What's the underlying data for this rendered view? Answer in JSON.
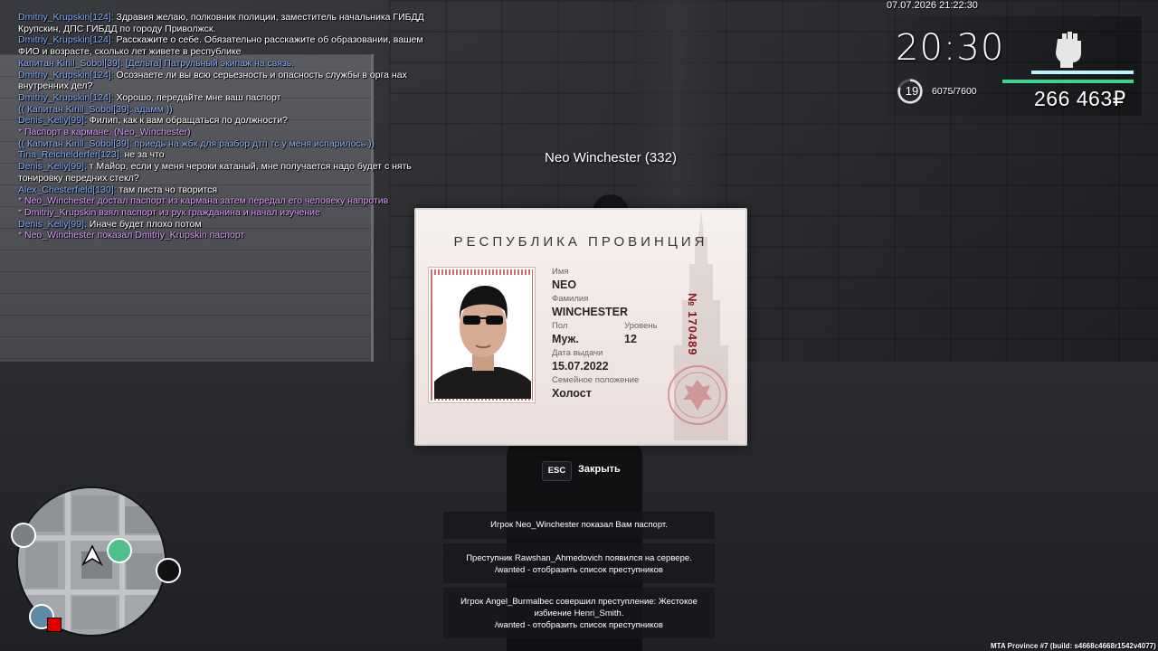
{
  "chat": [
    {
      "nick": "Dmitriy_Krupskin[124]:",
      "text": " Здравия желаю, полковник полиции, заместитель начальника ГИБДД Крупскин, ДПС ГИБДД по городу Приволжск.",
      "kind": "say"
    },
    {
      "nick": "Dmitriy_Krupskin[124]:",
      "text": " Расскажите о себе. Обязательно расскажите об образовании, вашем ФИО и возрасте, сколько лет живете в республике",
      "kind": "say"
    },
    {
      "nick": "",
      "text": "Капитан Kirill_Sobol[39]: [Дельта] Патрульный экипаж на связь.",
      "kind": "radio"
    },
    {
      "nick": "Dmitriy_Krupskin[124]:",
      "text": " Осознаете ли вы всю серьезность и опасность службы в орга нах внутренних дел?",
      "kind": "say"
    },
    {
      "nick": "Dmitriy_Krupskin[124]:",
      "text": " Хорошо, передайте мне ваш паспорт",
      "kind": "say"
    },
    {
      "nick": "",
      "text": "(( Капитан Kirill_Sobol[39]: адамм ))",
      "kind": "radio"
    },
    {
      "nick": "Denis_Kelly[99]:",
      "text": " Филип, как к вам обращаться по должности?",
      "kind": "say"
    },
    {
      "nick": "",
      "text": "* Паспорт в кармане. (Neo_Winchester)",
      "kind": "me"
    },
    {
      "nick": "",
      "text": "(( Капитан Kirill_Sobol[39]: приедь на жбк для разбор дтп тс у меня испарилось ))",
      "kind": "radio"
    },
    {
      "nick": "Tina_Reichelderfer[123]:",
      "text": " не за что",
      "kind": "say"
    },
    {
      "nick": "Denis_Kelly[99]:",
      "text": " т Майор, если у меня чероки катаный, мне получается надо будет с нять тонировку передних стекл?",
      "kind": "say"
    },
    {
      "nick": "Alex_Chesterfield[130]:",
      "text": " там писта чо творится",
      "kind": "say"
    },
    {
      "nick": "",
      "text": "* Neo_Winchester достал паспорт из кармана затем передал его человеку напротив",
      "kind": "me"
    },
    {
      "nick": "",
      "text": "* Dmitriy_Krupskin взял паспорт из рук гражданина и начал изучение",
      "kind": "me"
    },
    {
      "nick": "Denis_Kelly[99]:",
      "text": " Иначе будет плохо потом",
      "kind": "say"
    },
    {
      "nick": "",
      "text": "* Neo_Winchester показал Dmitriy_Krupskin паспорт",
      "kind": "me"
    }
  ],
  "hud": {
    "datetime": "07.07.2026 21:22:30",
    "time": "20:30",
    "level": "19",
    "xp": "6075/7600",
    "xp_fraction": 0.8,
    "money": "266 463₽",
    "fist_icon": "fist-icon"
  },
  "nametag": "Neo Winchester (332)",
  "passport": {
    "title": "РЕСПУБЛИКА ПРОВИНЦИЯ",
    "number": "№ 170489",
    "fields": {
      "name_label": "Имя",
      "name": "NEO",
      "surname_label": "Фамилия",
      "surname": "WINCHESTER",
      "sex_label": "Пол",
      "sex": "Муж.",
      "level_label": "Уровень",
      "level": "12",
      "issue_label": "Дата выдачи",
      "issue": "15.07.2022",
      "marital_label": "Семейное положение",
      "marital": "Холост"
    }
  },
  "close": {
    "key": "ESC",
    "label": "Закрыть"
  },
  "notifications": [
    {
      "lines": [
        "Игрок Neo_Winchester показал Вам паспорт."
      ]
    },
    {
      "lines": [
        "Преступник Rawshan_Ahmedovich появился на сервере.",
        "/wanted - отобразить список преступников"
      ]
    },
    {
      "lines": [
        "Игрок Angel_Burmalbec совершил преступление: Жестокое",
        "избиение Henri_Smith.",
        "/wanted - отобразить список преступников"
      ]
    }
  ],
  "build": "MTA Province #7 (build: s4668c4668r1542v4077)",
  "colors": {
    "chat_nick": "#7fb0ff",
    "chat_me": "#e29cff",
    "bar_cyan": "#bdf2ff",
    "bar_green": "#3dd58e",
    "passport_number": "#8a1a1a"
  }
}
